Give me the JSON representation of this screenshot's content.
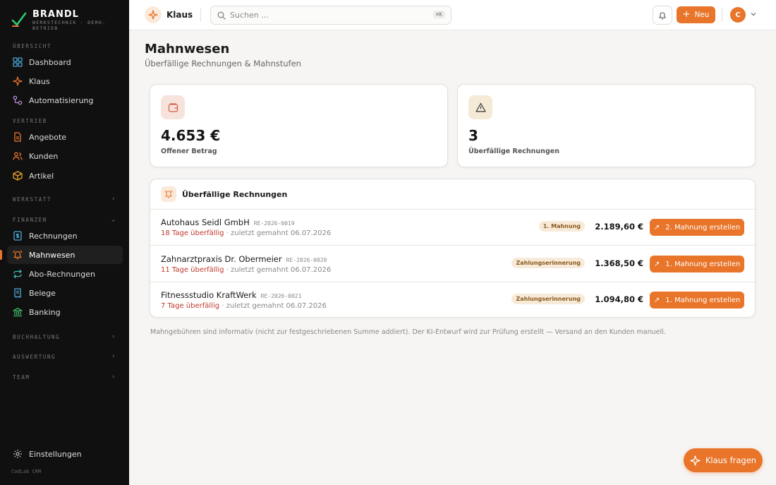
{
  "brand": {
    "name": "BRANDL",
    "subtitle": "WERKSTECHNIK · DEMO-BETRIEB"
  },
  "sidebar": {
    "sections": {
      "overview": "ÜBERSICHT",
      "sales": "VERTRIEB",
      "workshop": "WERKSTATT",
      "finance": "FINANZEN",
      "accounting": "BUCHHALTUNG",
      "analytics": "AUSWERTUNG",
      "team": "TEAM"
    },
    "items": {
      "dashboard": "Dashboard",
      "klaus": "Klaus",
      "automation": "Automatisierung",
      "quotes": "Angebote",
      "customers": "Kunden",
      "articles": "Artikel",
      "invoices": "Rechnungen",
      "dunning": "Mahnwesen",
      "subscriptions": "Abo-Rechnungen",
      "receipts": "Belege",
      "banking": "Banking",
      "settings": "Einstellungen"
    },
    "footer": "CodLab CRM"
  },
  "topbar": {
    "app_name": "Klaus",
    "search_placeholder": "Suchen ...",
    "search_shortcut": "⌘K",
    "new_label": "Neu",
    "avatar_initial": "C"
  },
  "page": {
    "title": "Mahnwesen",
    "subtitle": "Überfällige Rechnungen & Mahnstufen"
  },
  "stats": {
    "open_amount": {
      "value": "4.653 €",
      "label": "Offener Betrag"
    },
    "overdue_count": {
      "value": "3",
      "label": "Überfällige Rechnungen"
    }
  },
  "overdue": {
    "title": "Überfällige Rechnungen",
    "rows": [
      {
        "customer": "Autohaus Seidl GmbH",
        "invoice": "RE-2026-0019",
        "overdue": "18 Tage überfällig",
        "last": " · zuletzt gemahnt 06.07.2026",
        "badge": "1. Mahnung",
        "amount": "2.189,60 €",
        "action": "2. Mahnung erstellen"
      },
      {
        "customer": "Zahnarztpraxis Dr. Obermeier",
        "invoice": "RE-2026-0020",
        "overdue": "11 Tage überfällig",
        "last": " · zuletzt gemahnt 06.07.2026",
        "badge": "Zahlungserinnerung",
        "amount": "1.368,50 €",
        "action": "1. Mahnung erstellen"
      },
      {
        "customer": "Fitnessstudio KraftWerk",
        "invoice": "RE-2026-0021",
        "overdue": "7 Tage überfällig",
        "last": " · zuletzt gemahnt 06.07.2026",
        "badge": "Zahlungserinnerung",
        "amount": "1.094,80 €",
        "action": "1. Mahnung erstellen"
      }
    ]
  },
  "note": "Mahngebühren sind informativ (nicht zur festgeschriebenen Summe addiert). Der KI-Entwurf wird zur Prüfung erstellt — Versand an den Kunden manuell.",
  "fab_label": "Klaus fragen",
  "colors": {
    "accent": "#e8752a",
    "sidebar_bg": "#101010",
    "overdue_text": "#c0392b",
    "badge_bg": "#f8ead8"
  }
}
